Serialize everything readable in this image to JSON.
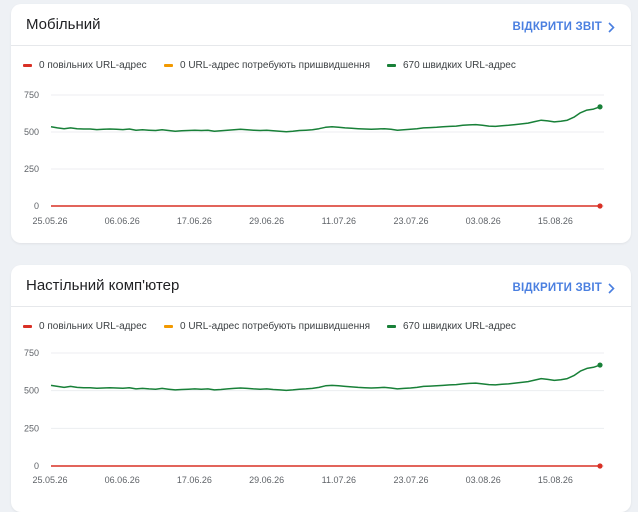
{
  "colors": {
    "slow": "#d93025",
    "improve": "#f29900",
    "fast": "#188038",
    "link": "#4a7fe0"
  },
  "cards": [
    {
      "title": "Мобільний",
      "open_report": "ВІДКРИТИ ЗВІТ",
      "legend": {
        "slow": "0 повільних URL-адрес",
        "improve": "0 URL-адрес потребують пришвидшення",
        "fast": "670 швидких URL-адрес"
      },
      "chart_data": {
        "type": "line",
        "x": [
          "25.05.26",
          "06.06.26",
          "17.06.26",
          "29.06.26",
          "11.07.26",
          "23.07.26",
          "03.08.26",
          "15.08.26"
        ],
        "y_ticks": [
          0,
          250,
          500,
          750
        ],
        "ylim": [
          0,
          750
        ],
        "series": [
          {
            "key": "fast",
            "values": [
              535,
              528,
              522,
              528,
              522,
              520,
              520,
              516,
              518,
              520,
              518,
              516,
              520,
              512,
              515,
              512,
              510,
              515,
              510,
              505,
              508,
              510,
              512,
              510,
              512,
              505,
              508,
              512,
              515,
              518,
              515,
              512,
              510,
              512,
              508,
              505,
              502,
              505,
              510,
              512,
              515,
              522,
              532,
              535,
              532,
              528,
              525,
              522,
              520,
              518,
              520,
              522,
              518,
              512,
              515,
              518,
              522,
              528,
              530,
              532,
              535,
              538,
              540,
              545,
              548,
              550,
              545,
              540,
              538,
              542,
              545,
              550,
              555,
              560,
              570,
              580,
              575,
              568,
              572,
              580,
              600,
              630,
              648,
              655,
              670
            ]
          },
          {
            "key": "slow",
            "values": [
              0,
              0,
              0,
              0,
              0,
              0,
              0,
              0,
              0,
              0,
              0,
              0,
              0,
              0,
              0,
              0,
              0,
              0,
              0,
              0,
              0,
              0,
              0,
              0,
              0,
              0,
              0,
              0,
              0,
              0,
              0,
              0,
              0,
              0,
              0,
              0,
              0,
              0,
              0,
              0,
              0,
              0,
              0,
              0,
              0,
              0,
              0,
              0,
              0,
              0,
              0,
              0,
              0,
              0,
              0,
              0,
              0,
              0,
              0,
              0,
              0,
              0,
              0,
              0,
              0,
              0,
              0,
              0,
              0,
              0,
              0,
              0,
              0,
              0,
              0,
              0,
              0,
              0,
              0,
              0,
              0,
              0,
              0,
              0,
              0
            ]
          }
        ]
      }
    },
    {
      "title": "Настільний комп'ютер",
      "open_report": "ВІДКРИТИ ЗВІТ",
      "legend": {
        "slow": "0 повільних URL-адрес",
        "improve": "0 URL-адрес потребують пришвидшення",
        "fast": "670 швидких URL-адрес"
      },
      "chart_data": {
        "type": "line",
        "x": [
          "25.05.26",
          "06.06.26",
          "17.06.26",
          "29.06.26",
          "11.07.26",
          "23.07.26",
          "03.08.26",
          "15.08.26"
        ],
        "y_ticks": [
          0,
          250,
          500,
          750
        ],
        "ylim": [
          0,
          750
        ],
        "series": [
          {
            "key": "fast",
            "values": [
              535,
              528,
              522,
              528,
              522,
              520,
              520,
              516,
              518,
              520,
              518,
              516,
              520,
              512,
              515,
              512,
              510,
              515,
              510,
              505,
              508,
              510,
              512,
              510,
              512,
              505,
              508,
              512,
              515,
              518,
              515,
              512,
              510,
              512,
              508,
              505,
              502,
              505,
              510,
              512,
              515,
              522,
              532,
              535,
              532,
              528,
              525,
              522,
              520,
              518,
              520,
              522,
              518,
              512,
              515,
              518,
              522,
              528,
              530,
              532,
              535,
              538,
              540,
              545,
              548,
              550,
              545,
              540,
              538,
              542,
              545,
              550,
              555,
              560,
              570,
              580,
              575,
              568,
              572,
              580,
              600,
              630,
              648,
              655,
              670
            ]
          },
          {
            "key": "slow",
            "values": [
              0,
              0,
              0,
              0,
              0,
              0,
              0,
              0,
              0,
              0,
              0,
              0,
              0,
              0,
              0,
              0,
              0,
              0,
              0,
              0,
              0,
              0,
              0,
              0,
              0,
              0,
              0,
              0,
              0,
              0,
              0,
              0,
              0,
              0,
              0,
              0,
              0,
              0,
              0,
              0,
              0,
              0,
              0,
              0,
              0,
              0,
              0,
              0,
              0,
              0,
              0,
              0,
              0,
              0,
              0,
              0,
              0,
              0,
              0,
              0,
              0,
              0,
              0,
              0,
              0,
              0,
              0,
              0,
              0,
              0,
              0,
              0,
              0,
              0,
              0,
              0,
              0,
              0,
              0,
              0,
              0,
              0,
              0,
              0,
              0
            ]
          }
        ]
      }
    }
  ]
}
